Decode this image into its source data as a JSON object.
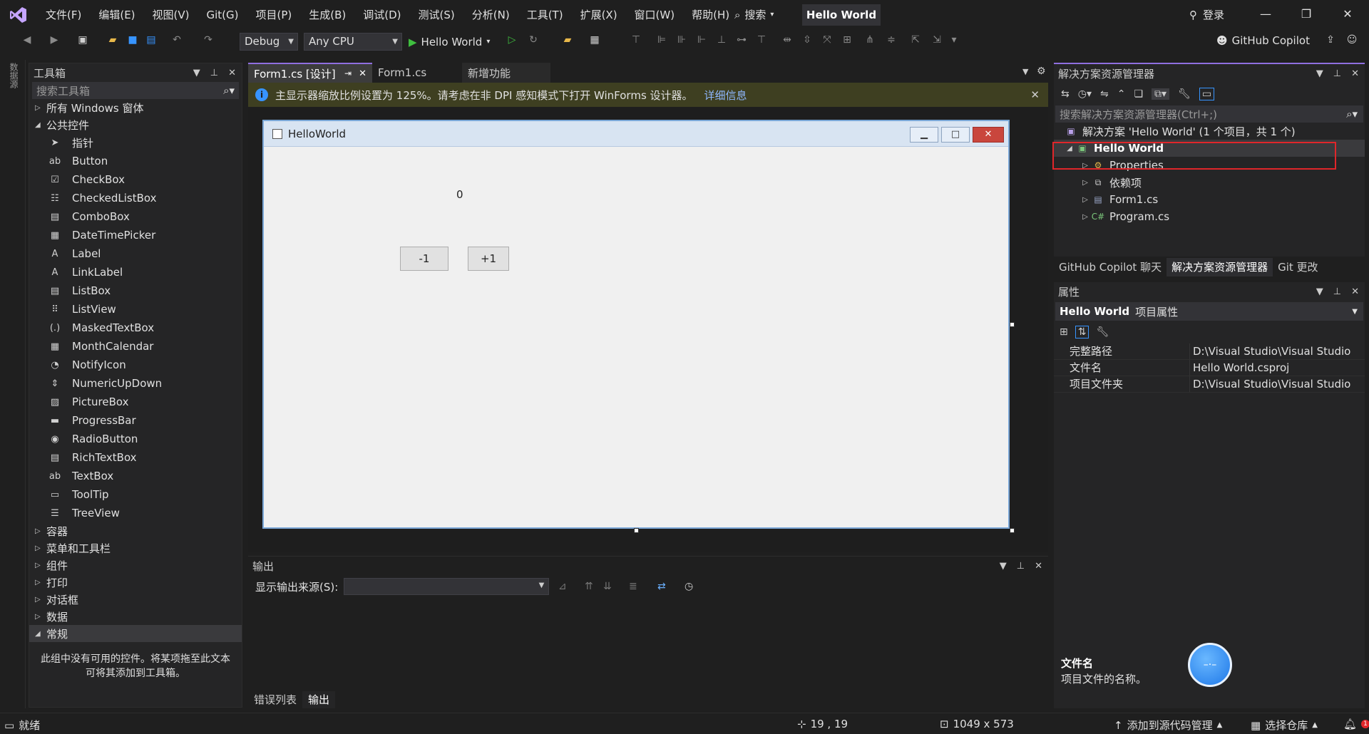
{
  "app": {
    "menu": [
      "文件(F)",
      "编辑(E)",
      "视图(V)",
      "Git(G)",
      "项目(P)",
      "生成(B)",
      "调试(D)",
      "测试(S)",
      "分析(N)",
      "工具(T)",
      "扩展(X)",
      "窗口(W)",
      "帮助(H)"
    ],
    "search_label": "搜索",
    "project_title": "Hello World",
    "login_label": "登录"
  },
  "toolbar": {
    "config": "Debug",
    "platform": "Any CPU",
    "run_label": "Hello World",
    "copilot_label": "GitHub Copilot"
  },
  "left_strip": {
    "label": "数据源"
  },
  "toolbox": {
    "title": "工具箱",
    "search_placeholder": "搜索工具箱",
    "cat_all": "所有 Windows 窗体",
    "cat_common": "公共控件",
    "items": [
      {
        "label": "指针",
        "icon": "pointer-icon"
      },
      {
        "label": "Button",
        "icon": "button-icon"
      },
      {
        "label": "CheckBox",
        "icon": "checkbox-icon"
      },
      {
        "label": "CheckedListBox",
        "icon": "checkedlistbox-icon"
      },
      {
        "label": "ComboBox",
        "icon": "combobox-icon"
      },
      {
        "label": "DateTimePicker",
        "icon": "datetimepicker-icon"
      },
      {
        "label": "Label",
        "icon": "label-icon"
      },
      {
        "label": "LinkLabel",
        "icon": "linklabel-icon"
      },
      {
        "label": "ListBox",
        "icon": "listbox-icon"
      },
      {
        "label": "ListView",
        "icon": "listview-icon"
      },
      {
        "label": "MaskedTextBox",
        "icon": "maskedtextbox-icon"
      },
      {
        "label": "MonthCalendar",
        "icon": "monthcalendar-icon"
      },
      {
        "label": "NotifyIcon",
        "icon": "notifyicon-icon"
      },
      {
        "label": "NumericUpDown",
        "icon": "numericupdown-icon"
      },
      {
        "label": "PictureBox",
        "icon": "picturebox-icon"
      },
      {
        "label": "ProgressBar",
        "icon": "progressbar-icon"
      },
      {
        "label": "RadioButton",
        "icon": "radiobutton-icon"
      },
      {
        "label": "RichTextBox",
        "icon": "richtextbox-icon"
      },
      {
        "label": "TextBox",
        "icon": "textbox-icon"
      },
      {
        "label": "ToolTip",
        "icon": "tooltip-icon"
      },
      {
        "label": "TreeView",
        "icon": "treeview-icon"
      }
    ],
    "categories": [
      "容器",
      "菜单和工具栏",
      "组件",
      "打印",
      "对话框",
      "数据"
    ],
    "cat_general": "常规",
    "empty_message": "此组中没有可用的控件。将某项拖至此文本可将其添加到工具箱。"
  },
  "tabs": {
    "designer": "Form1.cs [设计]",
    "code": "Form1.cs",
    "whats_new": "新增功能"
  },
  "infobar": {
    "message": "主显示器缩放比例设置为 125%。请考虑在非 DPI 感知模式下打开 WinForms 设计器。",
    "link": "详细信息"
  },
  "form": {
    "title": "HelloWorld",
    "counter": "0",
    "minus_label": "-1",
    "plus_label": "+1"
  },
  "output": {
    "title": "输出",
    "source_label": "显示输出来源(S):",
    "tab_errors": "错误列表",
    "tab_output": "输出"
  },
  "solution": {
    "title": "解决方案资源管理器",
    "search_placeholder": "搜索解决方案资源管理器(Ctrl+;)",
    "solution_node": "解决方案 'Hello World' (1 个项目，共 1 个)",
    "project_node": "Hello World",
    "children": [
      "Properties",
      "依赖项",
      "Form1.cs",
      "Program.cs"
    ],
    "tabs": [
      "GitHub Copilot 聊天",
      "解决方案资源管理器",
      "Git 更改"
    ]
  },
  "properties": {
    "title": "属性",
    "object_name": "Hello World",
    "object_type": "项目属性",
    "rows": [
      {
        "k": "完整路径",
        "v": "D:\\Visual Studio\\Visual Studio"
      },
      {
        "k": "文件名",
        "v": "Hello World.csproj"
      },
      {
        "k": "项目文件夹",
        "v": "D:\\Visual Studio\\Visual Studio"
      }
    ],
    "desc_title": "文件名",
    "desc_text": "项目文件的名称。"
  },
  "status": {
    "ready": "就绪",
    "position": "19 , 19",
    "size": "1049 x 573",
    "source_control": "添加到源代码管理",
    "repo": "选择仓库",
    "notifications": "1"
  }
}
